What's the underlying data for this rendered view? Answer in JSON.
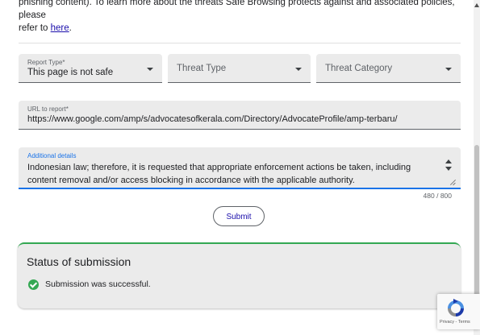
{
  "intro": {
    "line1": "phishing content). To learn more about the threats Safe Browsing protects against and associated policies, please",
    "line2_prefix": "refer to",
    "link": "here",
    "line2_suffix": "."
  },
  "form": {
    "report_type": {
      "label": "Report Type*",
      "value": "This page is not safe"
    },
    "threat_type": {
      "placeholder": "Threat Type"
    },
    "threat_category": {
      "placeholder": "Threat Category"
    },
    "url": {
      "label": "URL to report*",
      "value": "https://www.google.com/amp/s/advocatesofkerala.com/Directory/AdvocateProfile/amp-terbaru/"
    },
    "details": {
      "label": "Additional details",
      "value": "Indonesian law; therefore, it is requested that appropriate enforcement actions be taken, including content removal and/or access blocking in accordance with the applicable authority.",
      "counter": "480 / 800"
    },
    "submit_label": "Submit"
  },
  "status": {
    "title": "Status of submission",
    "message": "Submission was successful."
  },
  "recaptcha": {
    "terms": "Privacy - Terms"
  },
  "colors": {
    "accent": "#1a73e8",
    "success": "#34a853",
    "field_bg": "#ebebeb"
  }
}
